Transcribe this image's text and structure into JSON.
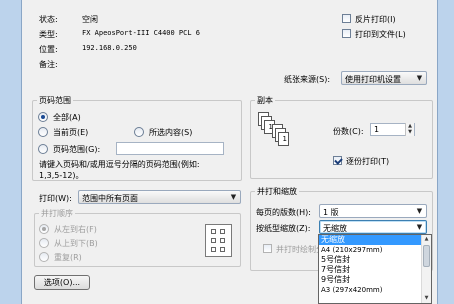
{
  "printer": {
    "status_label": "状态:",
    "status_value": "空闲",
    "type_label": "类型:",
    "type_value": "FX ApeosPort-III C4400 PCL 6",
    "location_label": "位置:",
    "location_value": "192.168.0.250",
    "comment_label": "备注:"
  },
  "options": {
    "reverse_print": "反片打印(I)",
    "print_to_file": "打印到文件(L)",
    "paper_source_label": "纸张来源(S):",
    "paper_source_value": "使用打印机设置"
  },
  "page_range": {
    "title": "页码范围",
    "all": "全部(A)",
    "current": "当前页(E)",
    "selection": "所选内容(S)",
    "pages": "页码范围(G):",
    "pages_value": "",
    "hint": "请键入页码和/或用逗号分隔的页码范围(例如:",
    "hint2": "1,3,5-12)。"
  },
  "copies": {
    "title": "副本",
    "count_label": "份数(C):",
    "count_value": "1",
    "collate": "逐份打印(T)"
  },
  "print_what": {
    "label": "打印(W):",
    "value": "范围中所有页面"
  },
  "print_order": {
    "title": "并打顺序",
    "ltr": "从左到右(F)",
    "ttb": "从上到下(B)",
    "repeat": "重复(R)"
  },
  "zoom": {
    "title": "并打和缩放",
    "pages_per_sheet_label": "每页的版数(H):",
    "pages_per_sheet_value": "1 版",
    "scale_label": "按纸型缩放(Z):",
    "scale_value": "无缩放",
    "draw_borders": "并打时绘制分"
  },
  "dropdown": {
    "items": [
      "无缩放",
      "A4 (210x297mm)",
      "5号信封",
      "7号信封",
      "9号信封",
      "A3 (297x420mm)"
    ]
  },
  "buttons": {
    "options": "选项(O)..."
  }
}
